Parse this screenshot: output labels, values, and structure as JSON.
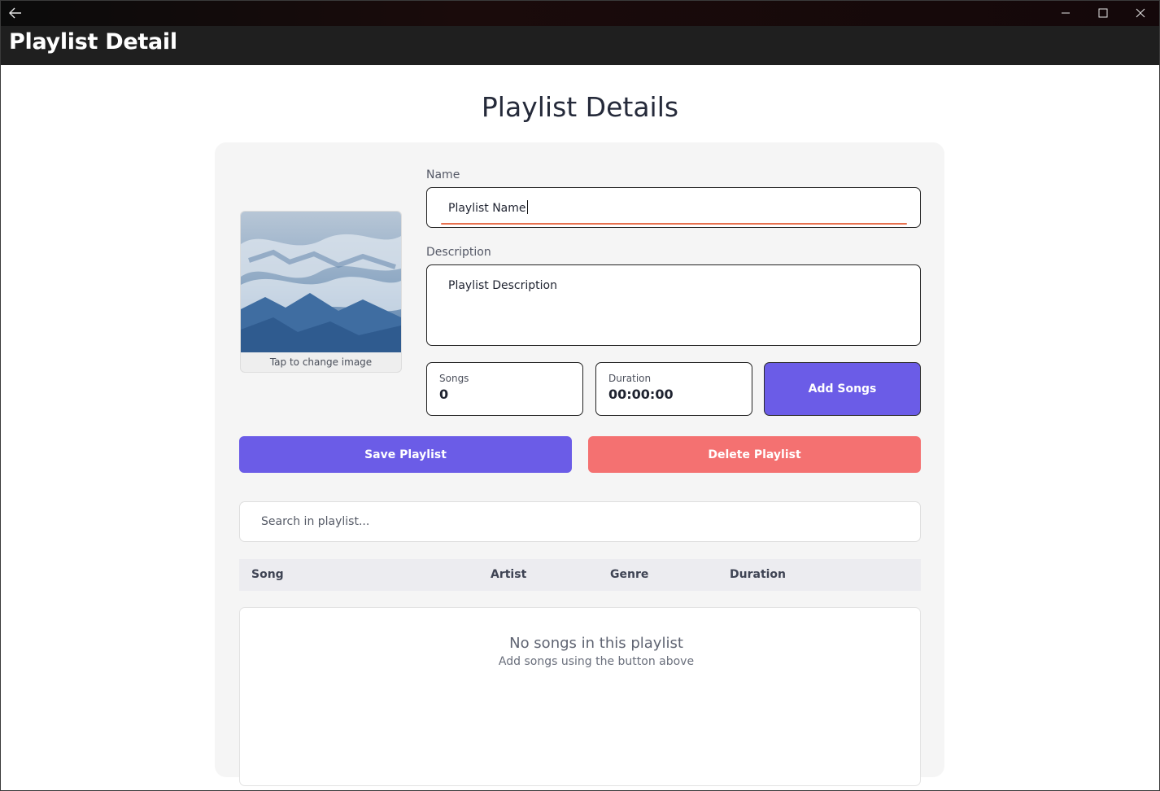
{
  "window": {
    "back_icon": "arrow-left-icon",
    "minimize_icon": "minimize-icon",
    "maximize_icon": "maximize-icon",
    "close_icon": "close-icon"
  },
  "header": {
    "title": "Playlist Detail"
  },
  "page": {
    "title": "Playlist Details"
  },
  "cover": {
    "caption": "Tap to change image"
  },
  "form": {
    "name_label": "Name",
    "name_value": "Playlist Name",
    "description_label": "Description",
    "description_value": "Playlist Description"
  },
  "stats": {
    "songs_label": "Songs",
    "songs_value": "0",
    "duration_label": "Duration",
    "duration_value": "00:00:00"
  },
  "buttons": {
    "add_songs": "Add Songs",
    "save": "Save Playlist",
    "delete": "Delete Playlist"
  },
  "search": {
    "placeholder": "Search in playlist..."
  },
  "table": {
    "columns": [
      "Song",
      "Artist",
      "Genre",
      "Duration"
    ]
  },
  "empty": {
    "title": "No songs in this playlist",
    "subtitle": "Add songs using the button above"
  },
  "colors": {
    "accent": "#6b5ce7",
    "danger": "#f47171",
    "focus_underline": "#e8714f",
    "header_bg": "#1f1f1f"
  }
}
